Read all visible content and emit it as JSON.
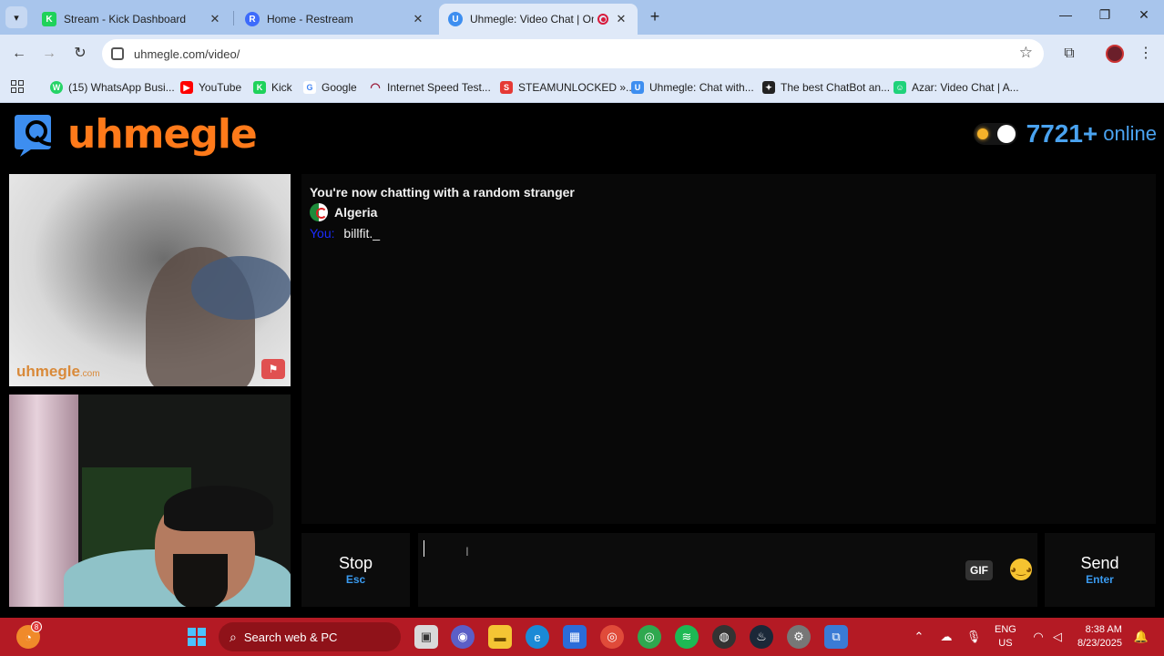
{
  "browser": {
    "tabs": [
      {
        "title": "Stream - Kick Dashboard",
        "favicon": "K",
        "favicon_color": "#1fd25a",
        "active": false
      },
      {
        "title": "Home - Restream",
        "favicon": "R",
        "favicon_color": "#3d6bfb",
        "active": false
      },
      {
        "title": "Uhmegle: Video Chat | Ome",
        "favicon": "U",
        "favicon_color": "#3d8ef0",
        "active": true
      }
    ],
    "url": "uhmegle.com/video/",
    "bookmarks": [
      {
        "label": "(15) WhatsApp Busi...",
        "color": "#25d366",
        "glyph": "W"
      },
      {
        "label": "YouTube",
        "color": "#ff0000",
        "glyph": "▶"
      },
      {
        "label": "Kick",
        "color": "#1fd25a",
        "glyph": "K"
      },
      {
        "label": "Google",
        "color": "#4285f4",
        "glyph": "G"
      },
      {
        "label": "Internet Speed Test...",
        "color": "#9b1c3a",
        "glyph": "◠"
      },
      {
        "label": "STEAMUNLOCKED »...",
        "color": "#e53935",
        "glyph": "S"
      },
      {
        "label": "Uhmegle: Chat with...",
        "color": "#3d8ef0",
        "glyph": "U"
      },
      {
        "label": "The best ChatBot an...",
        "color": "#222222",
        "glyph": "✦"
      },
      {
        "label": "Azar: Video Chat | A...",
        "color": "#20d27a",
        "glyph": "☺"
      }
    ]
  },
  "site": {
    "logo_text": "uhmegle",
    "online_count": "7721+",
    "online_label": "online",
    "watermark": "uhmegle",
    "watermark_suffix": ".com"
  },
  "chat": {
    "status": "You're now chatting with a random stranger",
    "country": "Algeria",
    "messages": [
      {
        "sender": "You:",
        "text": "billfit._"
      }
    ]
  },
  "controls": {
    "stop_label": "Stop",
    "stop_key": "Esc",
    "send_label": "Send",
    "send_key": "Enter",
    "gif_label": "GIF"
  },
  "taskbar": {
    "search_placeholder": "Search web & PC",
    "notification_badge": "8",
    "lang_top": "ENG",
    "lang_bottom": "US",
    "time": "8:38 AM",
    "date": "8/23/2025"
  },
  "colors": {
    "accent_orange": "#ff7a1a",
    "accent_blue": "#4aa3f0",
    "taskbar_red": "#b41a24"
  }
}
